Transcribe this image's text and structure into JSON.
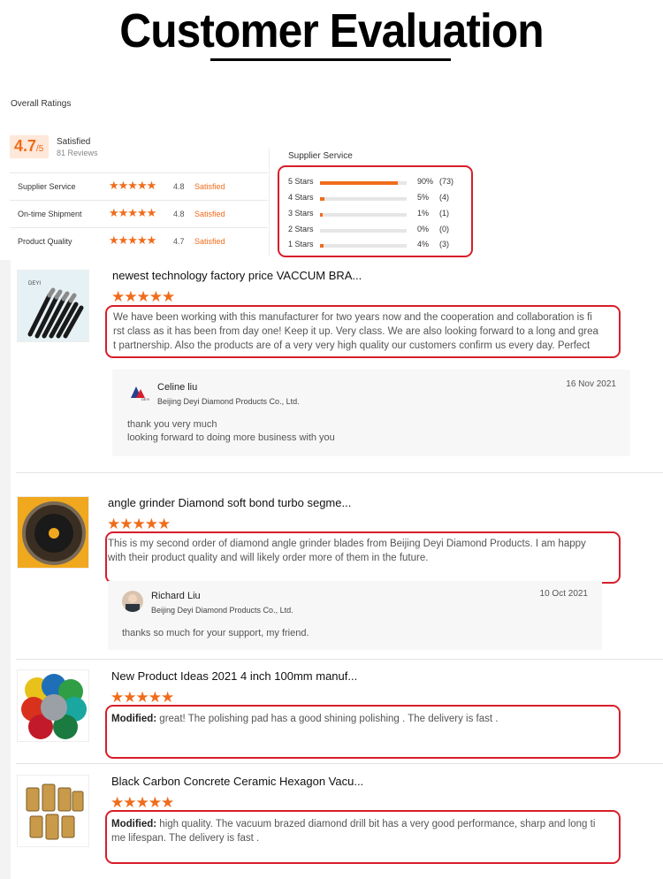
{
  "header": {
    "title": "Customer Evaluation"
  },
  "summary": {
    "overall_label": "Overall Ratings",
    "score": "4.7",
    "score_max": "/5",
    "status": "Satisfied",
    "reviews": "81 Reviews",
    "criteria": [
      {
        "label": "Supplier Service",
        "score": "4.8",
        "status": "Satisfied",
        "stars": 4.8
      },
      {
        "label": "On-time Shipment",
        "score": "4.8",
        "status": "Satisfied",
        "stars": 4.8
      },
      {
        "label": "Product Quality",
        "score": "4.7",
        "status": "Satisfied",
        "stars": 4.7
      }
    ]
  },
  "supplier_service": {
    "title": "Supplier Service",
    "rows": [
      {
        "label": "5 Stars",
        "percent": "90%",
        "count": "(73)",
        "fill": 0.9
      },
      {
        "label": "4 Stars",
        "percent": "5%",
        "count": "(4)",
        "fill": 0.05
      },
      {
        "label": "3 Stars",
        "percent": "1%",
        "count": "(1)",
        "fill": 0.01
      },
      {
        "label": "2 Stars",
        "percent": "0%",
        "count": "(0)",
        "fill": 0.0
      },
      {
        "label": "1 Stars",
        "percent": "4%",
        "count": "(3)",
        "fill": 0.04
      }
    ]
  },
  "reviews": [
    {
      "product": "newest technology factory price VACCUM BRA...",
      "stars": "★★★★★",
      "text_line1": "We have been working with this manufacturer for two years now and the cooperation and collaboration is fi",
      "text_line2": "rst class as it has been from day one! Keep it up. Very class. We are also looking forward to a long and grea",
      "text_line3": "t partnership. Also the products are of a very very high quality our customers confirm us every day. Perfect",
      "reply": {
        "name": "Celine liu",
        "company": "Beijing Deyi Diamond Products Co., Ltd.",
        "date": "16 Nov 2021",
        "line1": "thank you very much",
        "line2": "looking forward to doing more business with you"
      }
    },
    {
      "product": "angle grinder Diamond soft bond turbo segme...",
      "stars": "★★★★★",
      "text_line1": "This is my second order of diamond angle grinder blades from Beijing Deyi Diamond Products. I am happy",
      "text_line2": "with their product quality and will likely order more of them in the future.",
      "reply": {
        "name": "Richard Liu",
        "company": "Beijing Deyi Diamond Products Co., Ltd.",
        "date": "10 Oct 2021",
        "line1": "thanks so much for your support, my friend."
      }
    },
    {
      "product": "New Product Ideas 2021 4 inch 100mm manuf...",
      "stars": "★★★★★",
      "modified": "Modified:",
      "text_line1": " great! The polishing pad has a good shining polishing . The delivery is fast ."
    },
    {
      "product": "Black Carbon Concrete Ceramic Hexagon Vacu...",
      "stars": "★★★★★",
      "modified": "Modified:",
      "text_line1": " high quality. The vacuum brazed diamond drill bit has a very good performance, sharp and long ti",
      "text_line2": "me lifespan. The delivery is fast ."
    }
  ],
  "colors": {
    "accent": "#f06c1b",
    "highlight": "#d81e2a"
  }
}
